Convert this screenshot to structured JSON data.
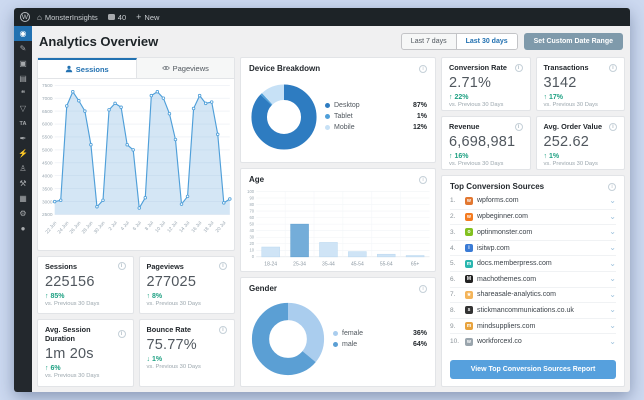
{
  "admin_bar": {
    "site_name": "MonsterInsights",
    "comments_count": "40",
    "new_label": "New"
  },
  "sidebar": {
    "items": [
      {
        "name": "dashboard",
        "glyph": "◉",
        "active": true
      },
      {
        "name": "posts-pin",
        "glyph": "✎",
        "active": false
      },
      {
        "name": "media",
        "glyph": "▣",
        "active": false
      },
      {
        "name": "pages",
        "glyph": "▤",
        "active": false
      },
      {
        "name": "comments",
        "glyph": "❝",
        "active": false
      },
      {
        "name": "feedback",
        "glyph": "▽",
        "active": false
      },
      {
        "name": "ta-plugin",
        "glyph": "TA",
        "active": false,
        "text": true
      },
      {
        "name": "appearance",
        "glyph": "✒",
        "active": false
      },
      {
        "name": "plugins",
        "glyph": "⚡",
        "active": false
      },
      {
        "name": "users",
        "glyph": "♙",
        "active": false
      },
      {
        "name": "tools",
        "glyph": "⚒",
        "active": false
      },
      {
        "name": "settings",
        "glyph": "▦",
        "active": false
      },
      {
        "name": "monsterinsights",
        "glyph": "⚙",
        "active": false
      },
      {
        "name": "collapse",
        "glyph": "●",
        "active": false
      }
    ]
  },
  "header": {
    "title": "Analytics Overview",
    "range_buttons": [
      {
        "label": "Last 7 days",
        "active": false
      },
      {
        "label": "Last 30 days",
        "active": true
      }
    ],
    "custom_range_label": "Set Custom Date Range"
  },
  "tabs": {
    "sessions": "Sessions",
    "pageviews": "Pageviews"
  },
  "chart_data": [
    {
      "id": "sessions_trend",
      "type": "area",
      "title": "Sessions",
      "x": [
        "22 Jun",
        "23 Jun",
        "24 Jun",
        "25 Jun",
        "26 Jun",
        "27 Jun",
        "28 Jun",
        "29 Jun",
        "30 Jun",
        "1 Jul",
        "2 Jul",
        "3 Jul",
        "4 Jul",
        "5 Jul",
        "6 Jul",
        "7 Jul",
        "8 Jul",
        "9 Jul",
        "10 Jul",
        "11 Jul",
        "12 Jul",
        "13 Jul",
        "14 Jul",
        "15 Jul",
        "16 Jul",
        "17 Jul",
        "18 Jul",
        "19 Jul",
        "20 Jul",
        "21 Jul"
      ],
      "values": [
        3000,
        3050,
        6700,
        7250,
        6900,
        6500,
        5200,
        2800,
        3050,
        6550,
        6800,
        6650,
        5200,
        5000,
        2750,
        3150,
        7100,
        7250,
        7000,
        6400,
        5400,
        2900,
        3200,
        6600,
        7100,
        6800,
        6850,
        5600,
        2950,
        3100
      ],
      "ylim": [
        2500,
        7500
      ],
      "ytick_step": 500,
      "xtick_every": 2,
      "grid": true,
      "line_color": "#4f9fd9",
      "fill_color": "rgba(133,183,227,0.35)"
    },
    {
      "id": "device_breakdown",
      "type": "pie",
      "title": "Device Breakdown",
      "labels": [
        "Desktop",
        "Tablet",
        "Mobile"
      ],
      "values": [
        87,
        1,
        12
      ],
      "colors": [
        "#2e7cc1",
        "#4f9fd9",
        "#c7e1f6"
      ],
      "legend_position": "right"
    },
    {
      "id": "age",
      "type": "bar",
      "title": "Age",
      "categories": [
        "18-24",
        "25-34",
        "35-44",
        "45-54",
        "55-64",
        "65+"
      ],
      "values": [
        15,
        50,
        22,
        8,
        4,
        2
      ],
      "ylim": [
        0,
        100
      ],
      "ytick_step": 10,
      "grid": true,
      "bar_color": "#cfe4f6",
      "highlight_index": 1,
      "highlight_color": "#74add9"
    },
    {
      "id": "gender",
      "type": "pie",
      "title": "Gender",
      "labels": [
        "female",
        "male"
      ],
      "values": [
        36,
        64
      ],
      "colors": [
        "#aacdee",
        "#5b9fd4"
      ],
      "legend_position": "right"
    }
  ],
  "metrics_left": [
    {
      "label": "Sessions",
      "value": "225156",
      "direction": "up",
      "change": "85%",
      "sub": "vs. Previous 30 Days"
    },
    {
      "label": "Pageviews",
      "value": "277025",
      "direction": "up",
      "change": "8%",
      "sub": "vs. Previous 30 Days"
    },
    {
      "label": "Avg. Session Duration",
      "value": "1m 20s",
      "direction": "up",
      "change": "6%",
      "sub": "vs. Previous 30 Days"
    },
    {
      "label": "Bounce Rate",
      "value": "75.77%",
      "direction": "down",
      "change": "1%",
      "sub": "vs. Previous 30 Days"
    }
  ],
  "metrics_right": [
    {
      "label": "Conversion Rate",
      "value": "2.71%",
      "direction": "up",
      "change": "22%",
      "sub": "vs. Previous 30 Days"
    },
    {
      "label": "Transactions",
      "value": "3142",
      "direction": "up",
      "change": "17%",
      "sub": "vs. Previous 30 Days"
    },
    {
      "label": "Revenue",
      "value": "6,698,981",
      "direction": "up",
      "change": "16%",
      "sub": "vs. Previous 30 Days"
    },
    {
      "label": "Avg. Order Value",
      "value": "252.62",
      "direction": "up",
      "change": "1%",
      "sub": "vs. Previous 30 Days"
    }
  ],
  "sources": {
    "title": "Top Conversion Sources",
    "items": [
      {
        "rank": "1.",
        "domain": "wpforms.com",
        "favicon_color": "#e27730",
        "letter": "w"
      },
      {
        "rank": "2.",
        "domain": "wpbeginner.com",
        "favicon_color": "#f47b20",
        "letter": "w"
      },
      {
        "rank": "3.",
        "domain": "optinmonster.com",
        "favicon_color": "#83c11f",
        "letter": "o"
      },
      {
        "rank": "4.",
        "domain": "isitwp.com",
        "favicon_color": "#3a7bd5",
        "letter": "i"
      },
      {
        "rank": "5.",
        "domain": "docs.memberpress.com",
        "favicon_color": "#29b6af",
        "letter": "m"
      },
      {
        "rank": "6.",
        "domain": "machothemes.com",
        "favicon_color": "#222222",
        "letter": "M"
      },
      {
        "rank": "7.",
        "domain": "shareasale-analytics.com",
        "favicon_color": "#f4b459",
        "letter": "★"
      },
      {
        "rank": "8.",
        "domain": "stickmancommunications.co.uk",
        "favicon_color": "#333333",
        "letter": "s"
      },
      {
        "rank": "9.",
        "domain": "mindsuppliers.com",
        "favicon_color": "#e8a33d",
        "letter": "m"
      },
      {
        "rank": "10.",
        "domain": "workforcexl.co",
        "favicon_color": "#9aa5ad",
        "letter": "w"
      }
    ],
    "button_label": "View Top Conversion Sources Report"
  },
  "colors": {
    "accent": "#2271b1",
    "positive": "#1fa183",
    "report_button": "#56a0dd",
    "custom_range_button": "#7f9aab",
    "admin_bar_bg": "#1d2327",
    "sidebar_bg": "#23282d"
  }
}
